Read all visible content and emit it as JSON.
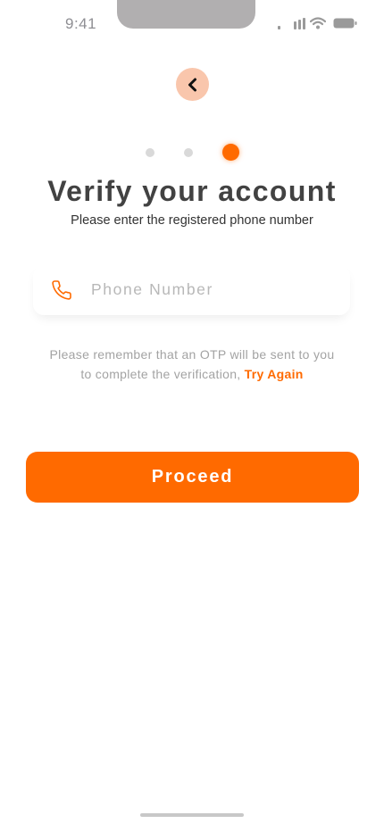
{
  "status_bar": {
    "time": "9:41",
    "icons": [
      "cellular-signal-icon",
      "wifi-icon",
      "battery-icon"
    ]
  },
  "nav": {
    "back_icon": "chevron-left-icon"
  },
  "steps": {
    "total": 3,
    "current": 3
  },
  "header": {
    "title": "Verify your account",
    "subtitle": "Please enter the registered phone number"
  },
  "phone_field": {
    "icon": "phone-icon",
    "placeholder": "Phone Number",
    "value": ""
  },
  "note": {
    "line1": "Please remember that an OTP will be sent to you",
    "line2": "to complete the verification,",
    "link": "Try Again"
  },
  "actions": {
    "proceed_label": "Proceed"
  },
  "colors": {
    "accent": "#ff6a00",
    "back_button_bg": "#f9c6ac",
    "title": "#424242",
    "muted_text": "#a3a3a3",
    "dot_inactive": "#d9d9d9"
  }
}
